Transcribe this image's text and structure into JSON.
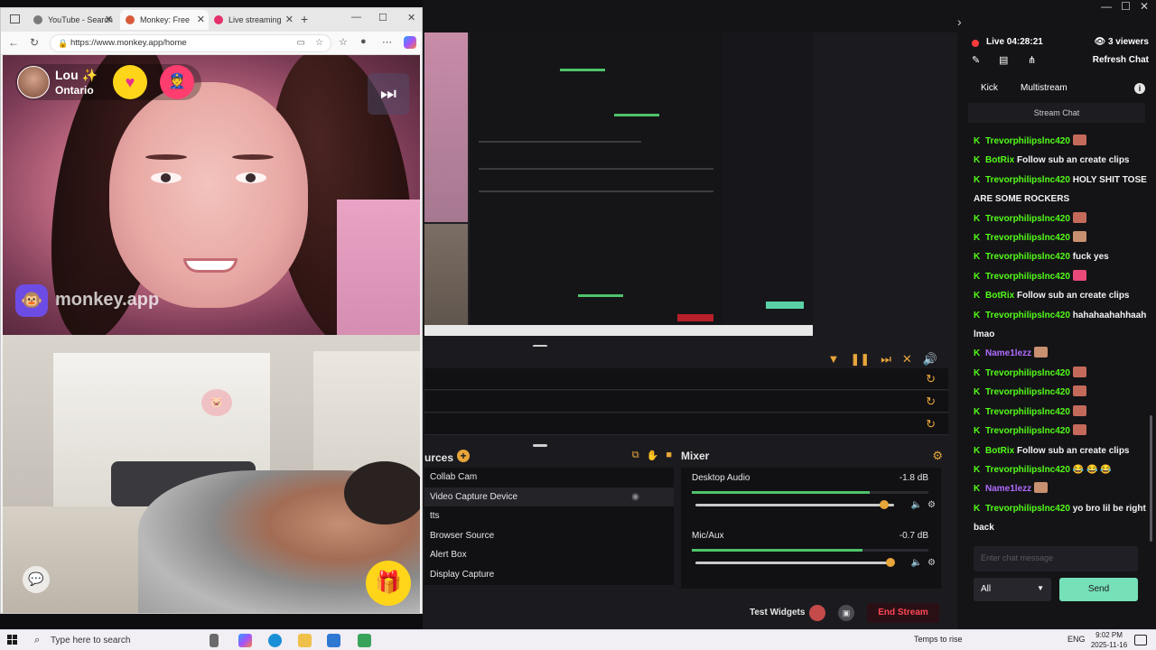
{
  "browser": {
    "tabs": [
      {
        "label": "YouTube - Search",
        "favicon_color": "#7a7a7a",
        "active": false
      },
      {
        "label": "Monkey: Free",
        "favicon_color": "#d85a3a",
        "active": true
      },
      {
        "label": "Live streaming",
        "favicon_color": "#e5306b",
        "active": false
      }
    ],
    "url": "https://www.monkey.app/home"
  },
  "monkey": {
    "partner_name": "Lou ✨",
    "partner_location": "Ontario",
    "brand_text": "monkey.app",
    "heart_icon": "♥",
    "skip_icon": "⏭",
    "gift_icon": "🎁",
    "chat_icon": "💬",
    "brand_icon": "🐵",
    "police_icon": "👮"
  },
  "obs": {
    "sources_title": "urces",
    "sources": [
      {
        "label": "Collab Cam",
        "selected": false
      },
      {
        "label": "Video Capture Device",
        "selected": true
      },
      {
        "label": "tts",
        "selected": false
      },
      {
        "label": "Browser Source",
        "selected": false
      },
      {
        "label": "Alert Box",
        "selected": false
      },
      {
        "label": "Display Capture",
        "selected": false
      }
    ],
    "mixer_title": "Mixer",
    "channels": [
      {
        "name": "Desktop Audio",
        "db": "-1.8 dB",
        "meter_level": 0.75,
        "volume": 0.95
      },
      {
        "name": "Mic/Aux",
        "db": "-0.7 dB",
        "meter_level": 0.72,
        "volume": 0.98
      }
    ],
    "test_widgets": "Test Widgets",
    "end_stream": "End Stream"
  },
  "chat_panel": {
    "live_time": "Live 04:28:21",
    "viewers": "3 viewers",
    "refresh": "Refresh Chat",
    "tabs": [
      "Kick",
      "Multistream"
    ],
    "stream_chat_title": "Stream Chat",
    "messages": [
      {
        "user": "Trevorphilipslnc420",
        "text": "",
        "emote": "#c46a5a",
        "purple": false
      },
      {
        "user": "BotRix",
        "text": "Follow sub an create clips",
        "emote": "",
        "purple": false
      },
      {
        "user": "Trevorphilipslnc420",
        "text": "HOLY SHIT TOSE ARE SOME ROCKERS",
        "emote": "",
        "purple": false
      },
      {
        "user": "Trevorphilipslnc420",
        "text": "",
        "emote": "#c46a5a",
        "purple": false
      },
      {
        "user": "Trevorphilipslnc420",
        "text": "",
        "emote": "#c89070",
        "purple": false
      },
      {
        "user": "Trevorphilipslnc420",
        "text": "fuck yes",
        "emote": "",
        "purple": false
      },
      {
        "user": "Trevorphilipslnc420",
        "text": "",
        "emote": "#e94a7a",
        "purple": false
      },
      {
        "user": "BotRix",
        "text": "Follow sub an create clips",
        "emote": "",
        "purple": false
      },
      {
        "user": "Trevorphilipslnc420",
        "text": "hahahaahahhaah lmao",
        "emote": "",
        "purple": false
      },
      {
        "user": "Name1lezz",
        "text": "",
        "emote": "#c89070",
        "purple": true
      },
      {
        "user": "Trevorphilipslnc420",
        "text": "",
        "emote": "#c46a5a",
        "purple": false
      },
      {
        "user": "Trevorphilipslnc420",
        "text": "",
        "emote": "#c46a5a",
        "purple": false
      },
      {
        "user": "Trevorphilipslnc420",
        "text": "",
        "emote": "#c46a5a",
        "purple": false
      },
      {
        "user": "Trevorphilipslnc420",
        "text": "",
        "emote": "#c46a5a",
        "purple": false
      },
      {
        "user": "BotRix",
        "text": "Follow sub an create clips",
        "emote": "",
        "purple": false
      },
      {
        "user": "Trevorphilipslnc420",
        "text": "😂 😂 😂",
        "emote": "",
        "purple": false
      },
      {
        "user": "Name1lezz",
        "text": "",
        "emote": "#c89070",
        "purple": true
      },
      {
        "user": "Trevorphilipslnc420",
        "text": "yo bro lil be right back",
        "emote": "",
        "purple": false
      }
    ],
    "input_placeholder": "Enter chat message",
    "select_value": "All",
    "send": "Send"
  },
  "taskbar": {
    "search_placeholder": "Type here to search",
    "weather": "Temps to rise",
    "language": "ENG",
    "time": "9:02 PM",
    "date": "2025-11-16"
  },
  "colors": {
    "kick_green": "#53fc18",
    "obs_accent": "#e8a53a",
    "end_stream_red": "#ff4655",
    "send_button": "#76e0b8"
  }
}
